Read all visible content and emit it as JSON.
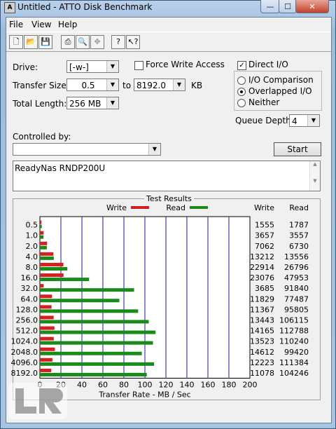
{
  "window": {
    "title": "Untitled - ATTO Disk Benchmark",
    "minimize": "—",
    "maximize": "☐",
    "close": "✕"
  },
  "menu": {
    "file": "File",
    "view": "View",
    "help": "Help"
  },
  "toolbar": {
    "icons": [
      "new-icon",
      "open-icon",
      "save-icon",
      "print-icon",
      "print-preview-icon",
      "move-icon",
      "help-icon",
      "context-help-icon"
    ]
  },
  "settings": {
    "drive_label": "Drive:",
    "drive_value": "[-w-]",
    "transfer_size_label": "Transfer Size:",
    "transfer_from": "0.5",
    "to_label": "to",
    "transfer_to": "8192.0",
    "kb_label": "KB",
    "total_length_label": "Total Length:",
    "total_length_value": "256 MB",
    "force_write_label": "Force Write Access",
    "force_write_checked": false,
    "direct_io_label": "Direct I/O",
    "direct_io_checked": true,
    "io_comparison_label": "I/O Comparison",
    "overlapped_io_label": "Overlapped I/O",
    "neither_label": "Neither",
    "io_mode_selected": "overlapped",
    "queue_depth_label": "Queue Depth:",
    "queue_depth_value": "4",
    "controlled_by_label": "Controlled by:",
    "controlled_by_value": "",
    "start_label": "Start",
    "description": "ReadyNas RNDP200U"
  },
  "chart_data": {
    "type": "bar",
    "title": "Test Results",
    "legend": {
      "write": "Write",
      "read": "Read",
      "placement": "top"
    },
    "columns": {
      "write": "Write",
      "read": "Read"
    },
    "xlabel": "Transfer Rate - MB / Sec",
    "xlim": [
      0,
      200
    ],
    "xticks": [
      "0",
      "20",
      "40",
      "60",
      "80",
      "100",
      "120",
      "140",
      "160",
      "180",
      "200"
    ],
    "categories": [
      "0.5",
      "1.0",
      "2.0",
      "4.0",
      "8.0",
      "16.0",
      "32.0",
      "64.0",
      "128.0",
      "256.0",
      "512.0",
      "1024.0",
      "2048.0",
      "4096.0",
      "8192.0"
    ],
    "series": [
      {
        "name": "Write",
        "color": "#d42020",
        "values": [
          1555,
          3657,
          7062,
          13212,
          22914,
          23076,
          3685,
          11829,
          11367,
          13443,
          14165,
          13523,
          14612,
          12223,
          11078
        ]
      },
      {
        "name": "Read",
        "color": "#1a8a1a",
        "values": [
          1787,
          3557,
          6730,
          13556,
          26796,
          47953,
          91840,
          77487,
          95805,
          106115,
          112788,
          110240,
          99420,
          111384,
          104246
        ]
      }
    ],
    "write_labels": [
      "1555",
      "3657",
      "7062",
      "13212",
      "22914",
      "23076",
      "3685",
      "11829",
      "11367",
      "13443",
      "14165",
      "13523",
      "14612",
      "12223",
      "11078"
    ],
    "read_labels": [
      "1787",
      "3557",
      "6730",
      "13556",
      "26796",
      "47953",
      "91840",
      "77487",
      "95805",
      "106115",
      "112788",
      "110240",
      "99420",
      "111384",
      "104246"
    ],
    "grid": true
  }
}
